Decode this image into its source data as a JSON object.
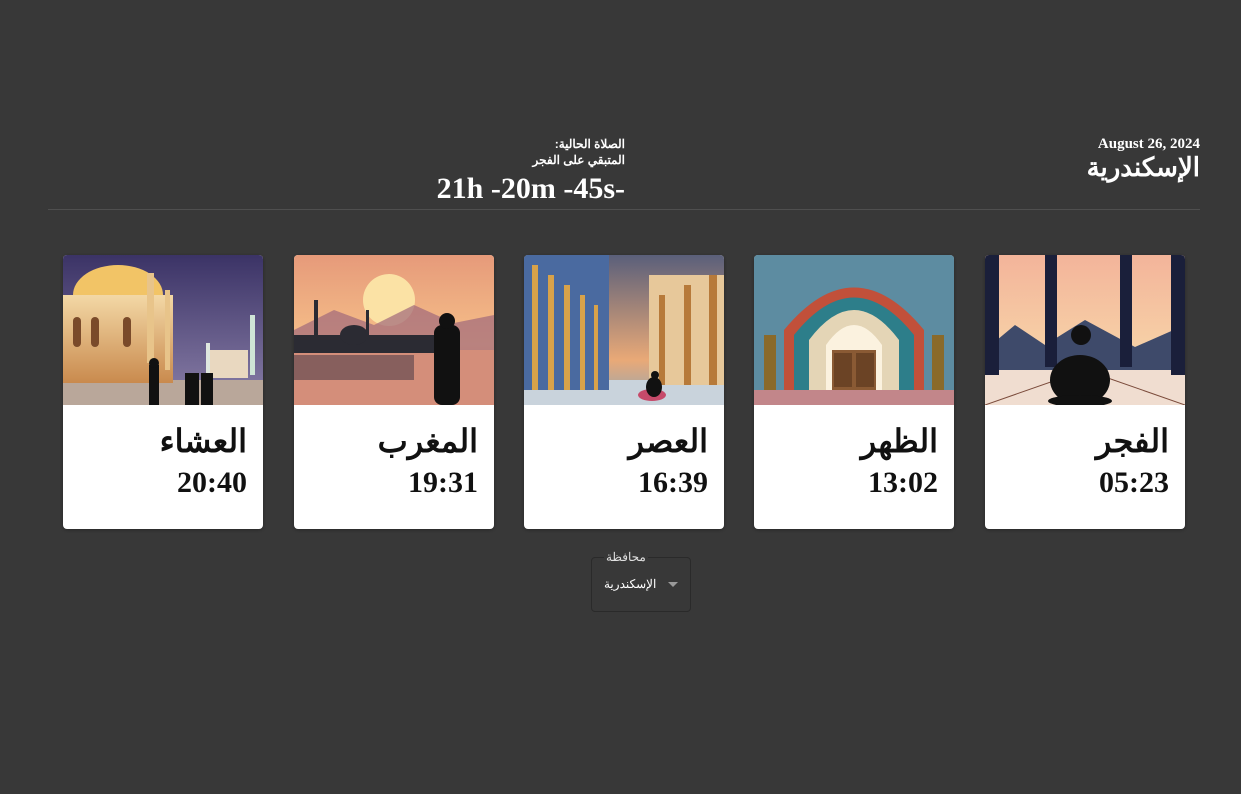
{
  "header": {
    "date": "August 26, 2024",
    "city": "الإسكندرية",
    "current_prayer_label": "الصلاة الحالية:",
    "remaining_label": "المتبقي على الفجر",
    "countdown": "21h -20m -45s-"
  },
  "prayers": [
    {
      "name": "الفجر",
      "time": "05:23",
      "image_icon": "praying-man-silhouette-window"
    },
    {
      "name": "الظهر",
      "time": "13:02",
      "image_icon": "mosque-arch-doorway"
    },
    {
      "name": "العصر",
      "time": "16:39",
      "image_icon": "mosque-colonnade-sunset"
    },
    {
      "name": "المغرب",
      "time": "19:31",
      "image_icon": "sunset-mosque-silhouette"
    },
    {
      "name": "العشاء",
      "time": "20:40",
      "image_icon": "night-mosque-dome"
    }
  ],
  "governorate_select": {
    "label": "محافظة",
    "value": "الإسكندرية"
  },
  "colors": {
    "background": "#383838",
    "card": "#ffffff",
    "text": "#ffffff"
  }
}
